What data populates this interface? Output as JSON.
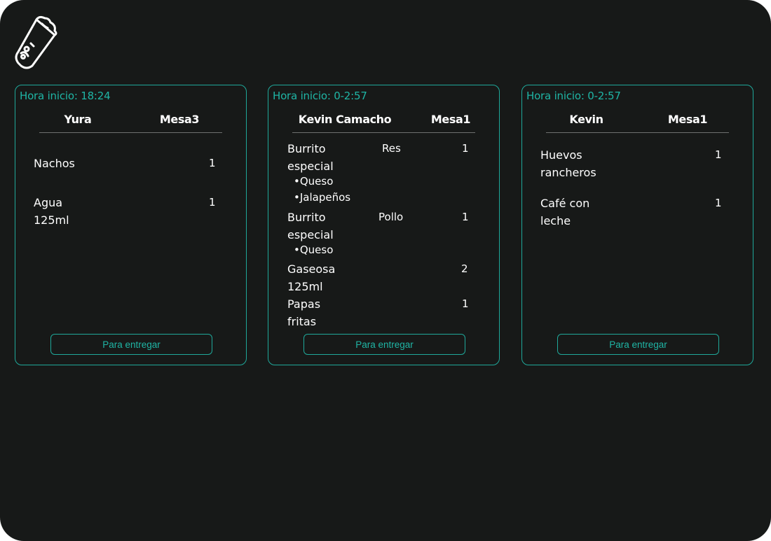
{
  "logo": {
    "icon": "burrito-icon",
    "color": "#ffffff"
  },
  "accent_color": "#1fb5a5",
  "orders": [
    {
      "time": "Hora inicio: 18:24",
      "customer": "Yura",
      "table": "Mesa3",
      "items": [
        {
          "name": "Nachos",
          "qty": "1"
        },
        {
          "name": "Agua 125ml",
          "qty": "1"
        }
      ],
      "button": "Para entregar"
    },
    {
      "time": "Hora inicio: 0-2:57",
      "customer": "Kevin Camacho",
      "table": "Mesa1",
      "items": [
        {
          "name": "Burrito especial",
          "variant": "Res",
          "qty": "1",
          "extras": [
            "•Queso",
            "•Jalapeños"
          ]
        },
        {
          "name": "Burrito especial",
          "variant": "Pollo",
          "qty": "1",
          "extras": [
            "•Queso"
          ]
        },
        {
          "name": "Gaseosa 125ml",
          "qty": "2"
        },
        {
          "name": "Papas fritas",
          "qty": "1"
        }
      ],
      "button": "Para entregar"
    },
    {
      "time": "Hora inicio: 0-2:57",
      "customer": "Kevin",
      "table": "Mesa1",
      "items": [
        {
          "name": "Huevos rancheros",
          "qty": "1"
        },
        {
          "name": "Café con leche",
          "qty": "1"
        }
      ],
      "button": "Para entregar"
    }
  ]
}
